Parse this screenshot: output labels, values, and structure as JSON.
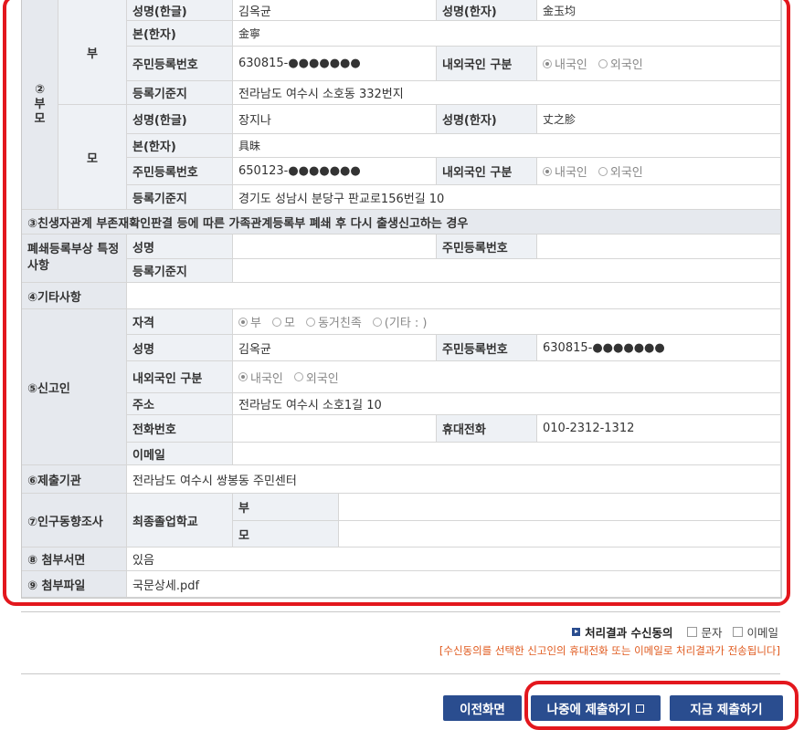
{
  "parents": {
    "section_label": "② 부 모",
    "father": {
      "label": "부",
      "name_hangul_label": "성명(한글)",
      "name_hangul": "김옥균",
      "name_hanja_label": "성명(한자)",
      "name_hanja": "金玉均",
      "origin_label": "본(한자)",
      "origin": "金寧",
      "rrn_label": "주민등록번호",
      "rrn": "630815-●●●●●●●",
      "nationality_label": "내외국인 구분",
      "nationality_options": [
        "내국인",
        "외국인"
      ],
      "nationality_selected": "내국인",
      "address_label": "등록기준지",
      "address": "전라남도 여수시 소호동 332번지"
    },
    "mother": {
      "label": "모",
      "name_hangul_label": "성명(한글)",
      "name_hangul": "장지나",
      "name_hanja_label": "성명(한자)",
      "name_hanja": "丈之胗",
      "origin_label": "본(한자)",
      "origin": "具昧",
      "rrn_label": "주민등록번호",
      "rrn": "650123-●●●●●●●",
      "nationality_label": "내외국인 구분",
      "nationality_options": [
        "내국인",
        "외국인"
      ],
      "nationality_selected": "내국인",
      "address_label": "등록기준지",
      "address": "경기도 성남시 분당구 판교로156번길 10"
    }
  },
  "section3": {
    "title": "③친생자관계 부존재확인판결 등에 따른 가족관계등록부 폐쇄 후 다시 출생신고하는 경우",
    "label": "폐쇄등록부상 특정사항",
    "name_label": "성명",
    "name": "",
    "rrn_label": "주민등록번호",
    "rrn": "",
    "address_label": "등록기준지",
    "address": ""
  },
  "section4": {
    "label": "④기타사항",
    "value": ""
  },
  "reporter": {
    "label": "⑤신고인",
    "qualification_label": "자격",
    "qualification_options": [
      "부",
      "모",
      "동거친족",
      "(기타 : )"
    ],
    "qualification_selected": "부",
    "name_label": "성명",
    "name": "김옥균",
    "rrn_label": "주민등록번호",
    "rrn": "630815-●●●●●●●",
    "nationality_label": "내외국인 구분",
    "nationality_options": [
      "내국인",
      "외국인"
    ],
    "nationality_selected": "내국인",
    "address_label": "주소",
    "address": "전라남도 여수시 소호1길 10",
    "phone_label": "전화번호",
    "phone": "",
    "mobile_label": "휴대전화",
    "mobile": "010-2312-1312",
    "email_label": "이메일",
    "email": ""
  },
  "section6": {
    "label": "⑥제출기관",
    "value": "전라남도 여수시 쌍봉동 주민센터"
  },
  "section7": {
    "label": "⑦인구동향조사",
    "sub_label": "최종졸업학교",
    "father_label": "부",
    "father_value": "",
    "mother_label": "모",
    "mother_value": ""
  },
  "section8": {
    "label": "⑧ 첨부서면",
    "value": "있음"
  },
  "section9": {
    "label": "⑨ 첨부파일",
    "value": "국문상세.pdf"
  },
  "consent": {
    "title": "처리결과 수신동의",
    "options": [
      "문자",
      "이메일"
    ],
    "note": "[수신동의를 선택한 신고인의 휴대전화 또는 이메일로 처리결과가 전송됩니다]"
  },
  "buttons": {
    "previous": "이전화면",
    "submit_later": "나중에 제출하기",
    "submit_now": "지금 제출하기"
  },
  "colors": {
    "button_bg": "#2a4d8f",
    "highlight_red": "#e3171d",
    "note_orange": "#e05a1e",
    "header_bg": "#eef1f5"
  },
  "icons": {
    "external_link": "external-link-icon",
    "consent_bullet": "arrow-bullet-icon"
  }
}
